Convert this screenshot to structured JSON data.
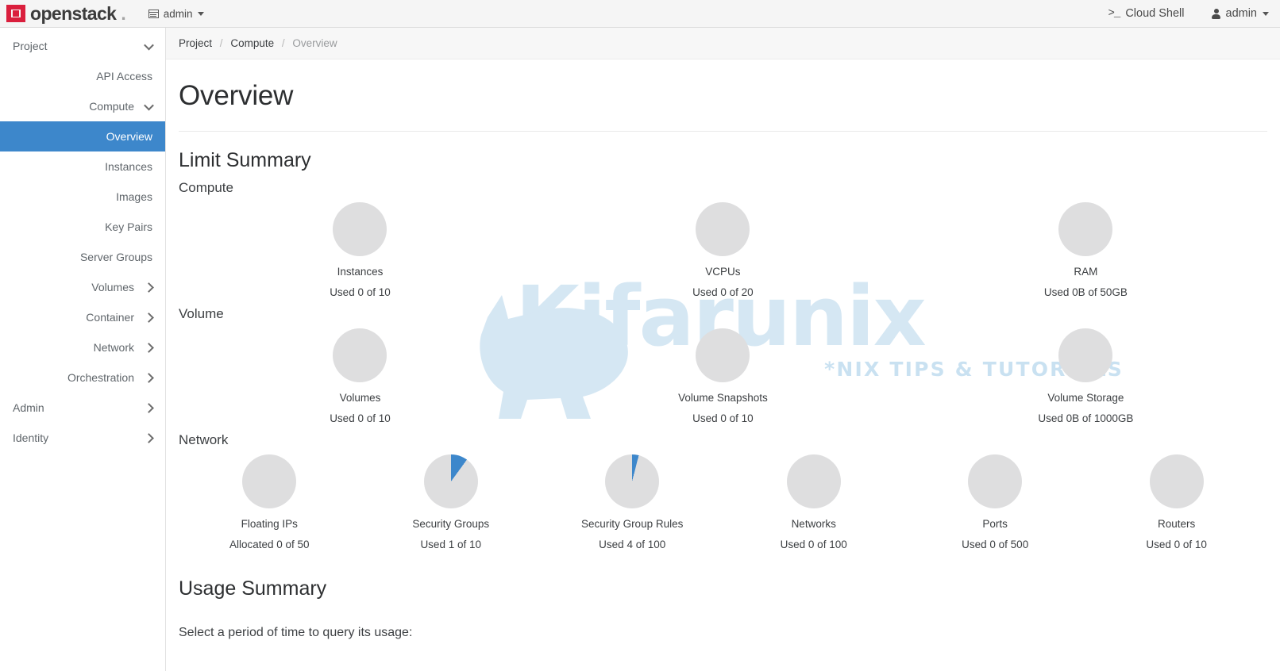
{
  "navbar": {
    "brand_name": "openstack",
    "brand_dot": ".",
    "context_label": "admin",
    "cloud_shell_label": "Cloud Shell",
    "cloud_shell_glyph": ">_",
    "user_label": "admin"
  },
  "sidebar": {
    "items": [
      {
        "label": "Project",
        "level": 0,
        "icon": "chevron-down-icon",
        "active": false
      },
      {
        "label": "API Access",
        "level": 1,
        "icon": "",
        "active": false
      },
      {
        "label": "Compute",
        "level": 1,
        "icon": "chevron-down-icon",
        "active": false
      },
      {
        "label": "Overview",
        "level": 2,
        "icon": "",
        "active": true
      },
      {
        "label": "Instances",
        "level": 2,
        "icon": "",
        "active": false
      },
      {
        "label": "Images",
        "level": 2,
        "icon": "",
        "active": false
      },
      {
        "label": "Key Pairs",
        "level": 2,
        "icon": "",
        "active": false
      },
      {
        "label": "Server Groups",
        "level": 2,
        "icon": "",
        "active": false
      },
      {
        "label": "Volumes",
        "level": 1,
        "icon": "chevron-right-icon",
        "active": false
      },
      {
        "label": "Container",
        "level": 1,
        "icon": "chevron-right-icon",
        "active": false
      },
      {
        "label": "Network",
        "level": 1,
        "icon": "chevron-right-icon",
        "active": false
      },
      {
        "label": "Orchestration",
        "level": 1,
        "icon": "chevron-right-icon",
        "active": false
      },
      {
        "label": "Admin",
        "level": 0,
        "icon": "chevron-right-icon",
        "active": false
      },
      {
        "label": "Identity",
        "level": 0,
        "icon": "chevron-right-icon",
        "active": false
      }
    ]
  },
  "breadcrumb": {
    "items": [
      "Project",
      "Compute",
      "Overview"
    ],
    "separator": "/"
  },
  "page": {
    "title": "Overview",
    "limit_summary_title": "Limit Summary",
    "usage_summary_title": "Usage Summary",
    "usage_prompt": "Select a period of time to query its usage:"
  },
  "watermark": {
    "word": "Kifarunix",
    "tagline": "*NIX TIPS & TUTORIALS"
  },
  "colors": {
    "accent_blue": "#3d87cb",
    "pie_used": "#3d87cb",
    "pie_free": "#dededf",
    "brand_red": "#da1f3d"
  },
  "chart_data": [
    {
      "type": "pie",
      "title": "Compute",
      "charts": [
        {
          "label": "Instances",
          "value_text": "Used 0 of 10",
          "used": 0,
          "total": 10,
          "unit": "",
          "percent": 0
        },
        {
          "label": "VCPUs",
          "value_text": "Used 0 of 20",
          "used": 0,
          "total": 20,
          "unit": "",
          "percent": 0
        },
        {
          "label": "RAM",
          "value_text": "Used 0B of 50GB",
          "used": 0,
          "total": 50,
          "unit": "GB",
          "percent": 0
        }
      ]
    },
    {
      "type": "pie",
      "title": "Volume",
      "charts": [
        {
          "label": "Volumes",
          "value_text": "Used 0 of 10",
          "used": 0,
          "total": 10,
          "unit": "",
          "percent": 0
        },
        {
          "label": "Volume Snapshots",
          "value_text": "Used 0 of 10",
          "used": 0,
          "total": 10,
          "unit": "",
          "percent": 0
        },
        {
          "label": "Volume Storage",
          "value_text": "Used 0B of 1000GB",
          "used": 0,
          "total": 1000,
          "unit": "GB",
          "percent": 0
        }
      ]
    },
    {
      "type": "pie",
      "title": "Network",
      "charts": [
        {
          "label": "Floating IPs",
          "value_text": "Allocated 0 of 50",
          "used": 0,
          "total": 50,
          "unit": "",
          "percent": 0
        },
        {
          "label": "Security Groups",
          "value_text": "Used 1 of 10",
          "used": 1,
          "total": 10,
          "unit": "",
          "percent": 10
        },
        {
          "label": "Security Group Rules",
          "value_text": "Used 4 of 100",
          "used": 4,
          "total": 100,
          "unit": "",
          "percent": 4
        },
        {
          "label": "Networks",
          "value_text": "Used 0 of 100",
          "used": 0,
          "total": 100,
          "unit": "",
          "percent": 0
        },
        {
          "label": "Ports",
          "value_text": "Used 0 of 500",
          "used": 0,
          "total": 500,
          "unit": "",
          "percent": 0
        },
        {
          "label": "Routers",
          "value_text": "Used 0 of 10",
          "used": 0,
          "total": 10,
          "unit": "",
          "percent": 0
        }
      ]
    }
  ]
}
